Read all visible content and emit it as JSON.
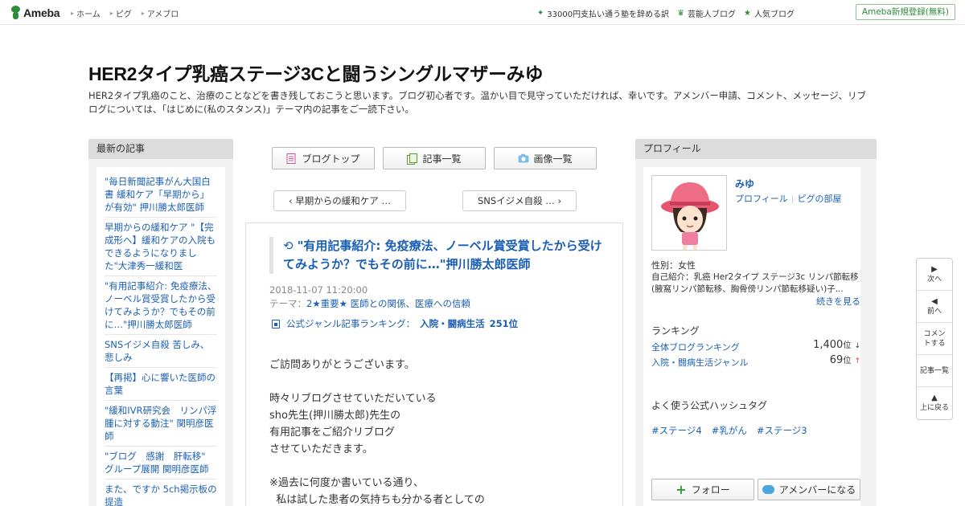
{
  "topbar": {
    "logo_text": "Ameba",
    "nav": [
      "ホーム",
      "ピグ",
      "アメブロ"
    ],
    "right_links": [
      {
        "icon": "sparkle-icon",
        "label": "33000円支払い通う塾を辞める訳"
      },
      {
        "icon": "crown-icon",
        "label": "芸能人ブログ"
      },
      {
        "icon": "star-icon",
        "label": "人気ブログ"
      }
    ],
    "register_label": "Ameba新規登録(無料)",
    "accent": "#2d8c3c"
  },
  "header": {
    "title": "HER2タイプ乳癌ステージ3Cと闘うシングルマザーみゆ",
    "description": "HER2タイプ乳癌のこと、治療のことなどを書き残しておこうと思います。ブログ初心者です。温かい目で見守っていただければ、幸いです。アメンバー申請、コメント、メッセージ、リブログについては、「はじめに(私のスタンス)」テーマ内の記事をご一読下さい。"
  },
  "left_sidebar": {
    "heading": "最新の記事",
    "items": [
      "\"毎日新聞記事がん大国白書 緩和ケア「早期から」が有効\" 押川勝太郎医師",
      "早期からの緩和ケア \"【完成形へ】緩和ケアの入院もできるようになりました\"大津秀一緩和医",
      "\"有用記事紹介: 免疫療法、ノーベル賞受賞したから受けてみようか？でもその前に…\"押川勝太郎医師",
      "SNSイジメ自殺 苦しみ、悲しみ",
      "【再掲】心に響いた医師の言葉",
      "\"緩和IVR研究会　リンパ浮腫に対する動注\" 関明彦医師",
      "\"ブログ　感謝　肝転移\" グループ展開 関明彦医師",
      "また、ですか 5ch掲示板の提造"
    ]
  },
  "main": {
    "buttons": [
      {
        "icon": "blog-top-icon",
        "label": "ブログトップ"
      },
      {
        "icon": "article-list-icon",
        "label": "記事一覧"
      },
      {
        "icon": "camera-icon",
        "label": "画像一覧"
      }
    ],
    "prev_label": "‹ 早期からの緩和ケア …",
    "next_label": "SNSイジメ自殺 … ›",
    "article": {
      "title": "\"有用記事紹介: 免疫療法、ノーベル賞受賞したから受けてみようか？でもその前に…\"押川勝太郎医師",
      "date": "2018-11-07 11:20:00",
      "theme_prefix": "テーマ：",
      "theme": "2★重要★ 医師との関係、医療への信頼",
      "ranking_label": "公式ジャンル記事ランキング：",
      "ranking_genre": "入院・闘病生活",
      "ranking_value": "251位",
      "body": "ご訪問ありがとうございます。\n\n時々リブログさせていただいている\nsho先生(押川勝太郎)先生の\n有用記事をご紹介リブログ\nさせていただきます。\n\n※過去に何度か書いている通り、\n  私は試した患者の気持ちも分かる者としての"
    }
  },
  "right_sidebar": {
    "heading": "プロフィール",
    "name": "みゆ",
    "profile_link": "プロフィール",
    "pig_link": "ピグの部屋",
    "gender": "性別：女性",
    "intro": "自己紹介：乳癌 Her2タイプ ステージ3c リンパ節転移 (腋窩リンパ節転移、胸骨傍リンパ節転移疑い)子...",
    "more_label": "続きを見る",
    "ranking_heading": "ランキング",
    "rankings": [
      {
        "label": "全体ブログランキング",
        "value": "1,400",
        "unit": "位",
        "trend": "↓"
      },
      {
        "label": "入院・闘病生活ジャンル",
        "value": "69",
        "unit": "位",
        "trend": "↑"
      }
    ],
    "hashtag_heading": "よく使う公式ハッシュタグ",
    "hashtags": [
      "#ステージ4",
      "#乳がん",
      "#ステージ3"
    ],
    "follow_label": "フォロー",
    "member_label": "アメンバーになる"
  },
  "float_nav": [
    {
      "icon": "next-triangle-icon",
      "label": "次へ"
    },
    {
      "icon": "prev-triangle-icon",
      "label": "前へ"
    },
    {
      "icon": "",
      "label": "コメントする"
    },
    {
      "icon": "",
      "label": "記事一覧"
    },
    {
      "icon": "up-triangle-icon",
      "label": "上に戻る"
    }
  ]
}
